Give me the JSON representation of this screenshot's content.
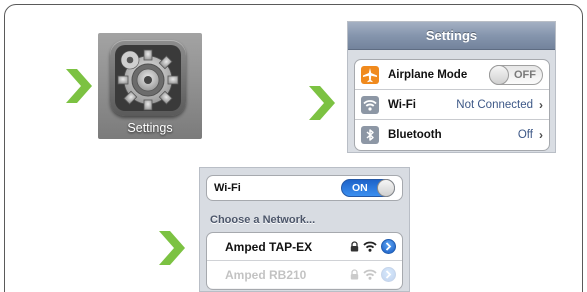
{
  "step1": {
    "app_label": "Settings",
    "icon": "settings-gear-icon"
  },
  "step2": {
    "nav_title": "Settings",
    "rows": [
      {
        "icon": "airplane-icon",
        "label": "Airplane Mode",
        "toggle": "OFF"
      },
      {
        "icon": "wifi-icon",
        "label": "Wi-Fi",
        "value": "Not Connected"
      },
      {
        "icon": "bluetooth-icon",
        "label": "Bluetooth",
        "value": "Off"
      }
    ]
  },
  "step3": {
    "wifi_label": "Wi-Fi",
    "wifi_toggle": "ON",
    "section_header": "Choose a Network...",
    "networks": [
      {
        "name": "Amped TAP-EX"
      },
      {
        "name": "Amped RB210"
      }
    ]
  },
  "colors": {
    "accent_green": "#7cc242",
    "ios_nav": "#8595ad",
    "toggle_on": "#2f7fe3"
  }
}
